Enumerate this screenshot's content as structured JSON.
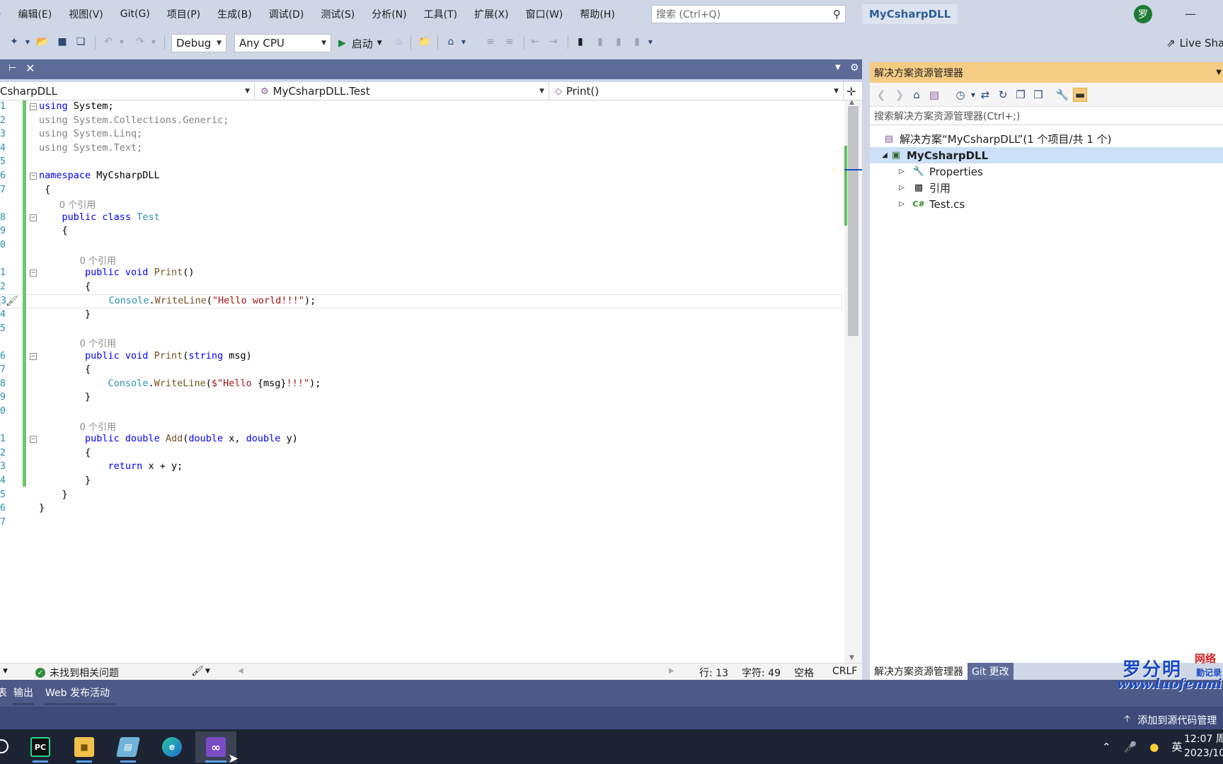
{
  "menu": {
    "items": [
      ")",
      "编辑(E)",
      "视图(V)",
      "Git(G)",
      "项目(P)",
      "生成(B)",
      "调试(D)",
      "测试(S)",
      "分析(N)",
      "工具(T)",
      "扩展(X)",
      "窗口(W)",
      "帮助(H)"
    ],
    "search_placeholder": "搜索 (Ctrl+Q)",
    "solution_name": "MyCsharpDLL",
    "avatar_initial": "罗",
    "minimize_glyph": "—"
  },
  "toolbar": {
    "config": "Debug",
    "platform": "Any CPU",
    "start_label": "启动",
    "live_share": "Live Sha"
  },
  "navbar": {
    "project": "CsharpDLL",
    "type": "MyCsharpDLL.Test",
    "member": "Print()"
  },
  "editor": {
    "lines": [
      {
        "n": "1",
        "parts": [
          [
            "kw",
            "using"
          ],
          [
            "",
            " System;"
          ]
        ]
      },
      {
        "n": "2",
        "parts": [
          [
            "gray",
            "using System.Collections.Generic;"
          ]
        ]
      },
      {
        "n": "3",
        "parts": [
          [
            "gray",
            "using System.Linq;"
          ]
        ]
      },
      {
        "n": "4",
        "parts": [
          [
            "gray",
            "using System.Text;"
          ]
        ]
      },
      {
        "n": "5",
        "parts": []
      },
      {
        "n": "6",
        "parts": [
          [
            "kw",
            "namespace"
          ],
          [
            "",
            " MyCsharpDLL"
          ]
        ]
      },
      {
        "n": "7",
        "parts": [
          [
            "",
            " {"
          ]
        ]
      },
      {
        "n": "",
        "hint": "0 个引用",
        "indent": 4
      },
      {
        "n": "8",
        "parts": [
          [
            "",
            "    "
          ],
          [
            "kw",
            "public class"
          ],
          [
            "",
            " "
          ],
          [
            "cls",
            "Test"
          ]
        ]
      },
      {
        "n": "9",
        "parts": [
          [
            "",
            "    {"
          ]
        ]
      },
      {
        "n": "0",
        "parts": []
      },
      {
        "n": "",
        "hint": "0 个引用",
        "indent": 8
      },
      {
        "n": "1",
        "parts": [
          [
            "",
            "        "
          ],
          [
            "kw",
            "public void"
          ],
          [
            "",
            " "
          ],
          [
            "fn",
            "Print"
          ],
          [
            "",
            "()"
          ]
        ]
      },
      {
        "n": "2",
        "parts": [
          [
            "",
            "        {"
          ]
        ]
      },
      {
        "n": "3",
        "current": true,
        "parts": [
          [
            "",
            "            "
          ],
          [
            "cls",
            "Console"
          ],
          [
            "",
            "."
          ],
          [
            "fn",
            "WriteLine"
          ],
          [
            "",
            "("
          ],
          [
            "str",
            "\"Hello world!!!\""
          ],
          [
            "",
            ");"
          ]
        ]
      },
      {
        "n": "4",
        "parts": [
          [
            "",
            "        }"
          ]
        ]
      },
      {
        "n": "5",
        "parts": []
      },
      {
        "n": "",
        "hint": "0 个引用",
        "indent": 8
      },
      {
        "n": "6",
        "parts": [
          [
            "",
            "        "
          ],
          [
            "kw",
            "public void"
          ],
          [
            "",
            " "
          ],
          [
            "fn",
            "Print"
          ],
          [
            "",
            "("
          ],
          [
            "kw",
            "string"
          ],
          [
            "",
            " msg)"
          ]
        ]
      },
      {
        "n": "7",
        "parts": [
          [
            "",
            "        {"
          ]
        ]
      },
      {
        "n": "8",
        "parts": [
          [
            "",
            "            "
          ],
          [
            "cls",
            "Console"
          ],
          [
            "",
            "."
          ],
          [
            "fn",
            "WriteLine"
          ],
          [
            "",
            "("
          ],
          [
            "str",
            "$\"Hello "
          ],
          [
            "",
            "{msg}"
          ],
          [
            "str",
            "!!!\""
          ],
          [
            "",
            ");"
          ]
        ]
      },
      {
        "n": "9",
        "parts": [
          [
            "",
            "        }"
          ]
        ]
      },
      {
        "n": "0",
        "parts": []
      },
      {
        "n": "",
        "hint": "0 个引用",
        "indent": 8
      },
      {
        "n": "1",
        "parts": [
          [
            "",
            "        "
          ],
          [
            "kw",
            "public double"
          ],
          [
            "",
            " "
          ],
          [
            "fn",
            "Add"
          ],
          [
            "",
            "("
          ],
          [
            "kw",
            "double"
          ],
          [
            "",
            " x, "
          ],
          [
            "kw",
            "double"
          ],
          [
            "",
            " y)"
          ]
        ]
      },
      {
        "n": "2",
        "parts": [
          [
            "",
            "        {"
          ]
        ]
      },
      {
        "n": "3",
        "parts": [
          [
            "",
            "            "
          ],
          [
            "kw",
            "return"
          ],
          [
            "",
            " x + y;"
          ]
        ]
      },
      {
        "n": "4",
        "parts": [
          [
            "",
            "        }"
          ]
        ]
      },
      {
        "n": "5",
        "parts": [
          [
            "",
            "    }"
          ]
        ]
      },
      {
        "n": "6",
        "parts": [
          [
            "",
            "}"
          ]
        ]
      },
      {
        "n": "7",
        "parts": []
      }
    ],
    "collapse_rows": [
      0,
      5,
      8,
      12,
      18,
      24
    ]
  },
  "status": {
    "issues": "未找到相关问题",
    "line": "行: 13",
    "char": "字符: 49",
    "whitespace": "空格",
    "eol": "CRLF"
  },
  "solution_explorer": {
    "title": "解决方案资源管理器",
    "search_placeholder": "搜索解决方案资源管理器(Ctrl+;)",
    "solution_label": "解决方案“MyCsharpDLL”(1 个项目/共 1 个)",
    "project_label": "MyCsharpDLL",
    "items": [
      "Properties",
      "引用",
      "Test.cs"
    ],
    "tab_solution": "解决方案资源管理器",
    "tab_git": "Git 更改"
  },
  "bottom_tabs": {
    "output": "输出",
    "web": "Web 发布活动",
    "partial_left": "表"
  },
  "vs_status": {
    "source_control": "添加到源代码管理"
  },
  "taskbar": {
    "ime": "英",
    "time": "12:07 周",
    "date": "2023/10"
  },
  "watermark": {
    "cn": "罗分明",
    "tag": "网络",
    "tag2": "勤记录",
    "url": "www.luofenming"
  },
  "colors": {
    "accent": "#f5cc84",
    "tab_strip": "#5d6b99",
    "status_bar": "#3e4a7a",
    "change_bar": "#6bc96b",
    "keyword": "#0000ff",
    "type": "#2b91af",
    "string": "#a31515"
  }
}
